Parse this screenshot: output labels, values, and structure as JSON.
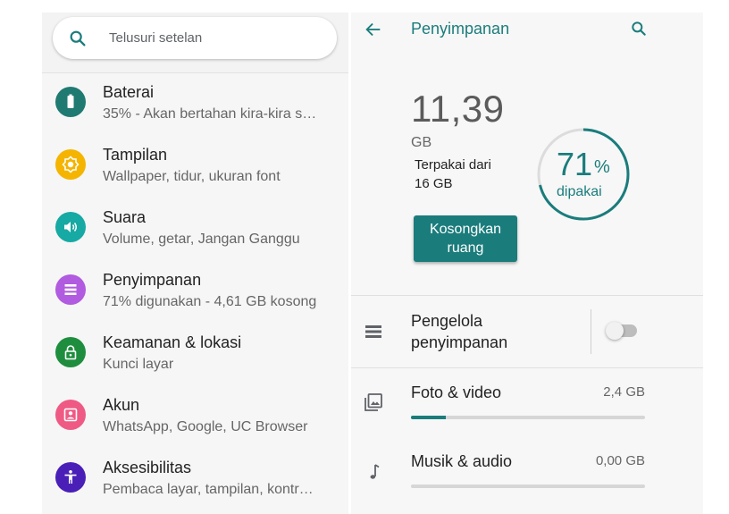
{
  "settings": {
    "search_placeholder": "Telusuri setelan",
    "items": [
      {
        "title": "Baterai",
        "subtitle": "35% - Akan bertahan kira-kira s…",
        "color": "#1f7a72"
      },
      {
        "title": "Tampilan",
        "subtitle": "Wallpaper, tidur, ukuran font",
        "color": "#f5b400"
      },
      {
        "title": "Suara",
        "subtitle": "Volume, getar, Jangan Ganggu",
        "color": "#17a9a3"
      },
      {
        "title": "Penyimpanan",
        "subtitle": "71% digunakan - 4,61 GB kosong",
        "color": "#b15be0"
      },
      {
        "title": "Keamanan & lokasi",
        "subtitle": "Kunci layar",
        "color": "#1e8e3e"
      },
      {
        "title": "Akun",
        "subtitle": "WhatsApp, Google, UC Browser",
        "color": "#ef5a84"
      },
      {
        "title": "Aksesibilitas",
        "subtitle": "Pembaca layar, tampilan, kontr…",
        "color": "#4a1fb8"
      }
    ]
  },
  "storage": {
    "title": "Penyimpanan",
    "used_amount": "11,39",
    "used_unit": "GB",
    "used_of_line1": "Terpakai dari",
    "used_of_line2": "16 GB",
    "percent": "71",
    "percent_symbol": "%",
    "percent_label": "dipakai",
    "percent_value": 71,
    "free_button_line1": "Kosongkan",
    "free_button_line2": "ruang",
    "manager_line1": "Pengelola",
    "manager_line2": "penyimpanan",
    "manager_enabled": false,
    "categories": [
      {
        "name": "Foto & video",
        "size": "2,4 GB",
        "fraction": 0.15
      },
      {
        "name": "Musik & audio",
        "size": "0,00 GB",
        "fraction": 0
      }
    ],
    "accent_color": "#1b7c7c"
  }
}
